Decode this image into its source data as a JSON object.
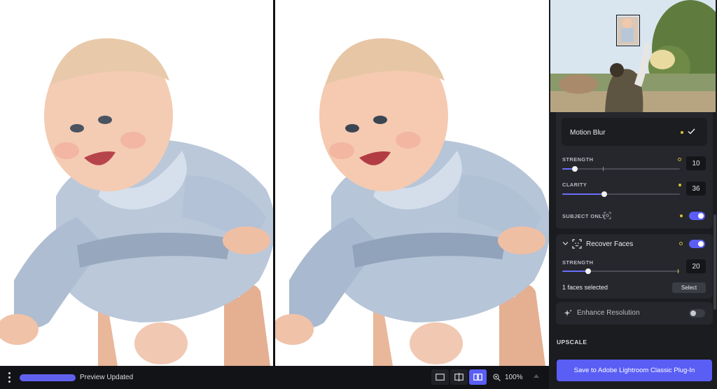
{
  "bottombar": {
    "status": "Preview Updated",
    "zoom": "100%",
    "progress": 1.0
  },
  "panel": {
    "motion_blur": {
      "label": "Motion Blur",
      "strength_label": "STRENGTH",
      "strength_value": "10",
      "strength_fraction": 0.11,
      "clarity_label": "CLARITY",
      "clarity_value": "36",
      "clarity_fraction": 0.36,
      "subject_only_label": "SUBJECT ONLY",
      "subject_only_enabled": true
    },
    "recover_faces": {
      "label": "Recover Faces",
      "enabled": true,
      "strength_label": "STRENGTH",
      "strength_value": "20",
      "strength_fraction": 0.22,
      "faces_selected": "1 faces selected",
      "select_label": "Select"
    },
    "enhance_resolution": {
      "label": "Enhance Resolution",
      "enabled": false
    },
    "upscale_heading": "UPSCALE",
    "save_label": "Save to Adobe Lightroom Classic Plug-In"
  },
  "colors": {
    "accent": "#5a5ef5",
    "panel_bg": "#1b1c20",
    "card_bg": "#25272c",
    "indicator_yellow": "#d8c23a"
  },
  "icons": {
    "menu": "kebab-menu-icon",
    "view_single": "single-view-icon",
    "view_split": "split-view-icon",
    "view_side": "side-by-side-icon",
    "zoom": "zoom-icon",
    "check": "check-icon",
    "subject": "subject-focus-icon",
    "face": "face-scan-icon",
    "sparkle": "sparkle-icon",
    "chevron": "chevron-down-icon"
  }
}
